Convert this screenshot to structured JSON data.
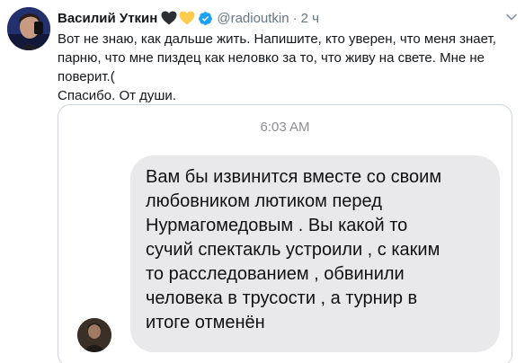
{
  "tweet": {
    "author_name": "Василий Уткин",
    "handle": "@radioutkin",
    "separator": "·",
    "time": "2 ч",
    "text_lines": [
      "Вот не знаю, как дальше жить. Напишите, кто уверен, что меня знает, парню, что мне пиздец как неловко за то, что живу на свете. Мне не поверит.(",
      "Спасибо. От души."
    ],
    "colors": {
      "heart_black": "#292f33",
      "heart_yellow": "#ffcc4d",
      "verified": "#1da1f2",
      "secondary_text": "#657786"
    },
    "icons": [
      "black-heart-icon",
      "yellow-heart-icon",
      "verified-badge-icon",
      "chevron-down-icon"
    ]
  },
  "message_screenshot": {
    "timestamp": "6:03 AM",
    "bubble_text": "Вам бы извинится вместе со своим\nлюбовником лютиком перед\nНурмагомедовым . Вы какой то\nсучий спектакль устроили , с каким\nто расследованием  , обвинили\nчеловека в трусости , а турнир в\nитоге отменён",
    "bubble_color": "#e9e9eb"
  }
}
